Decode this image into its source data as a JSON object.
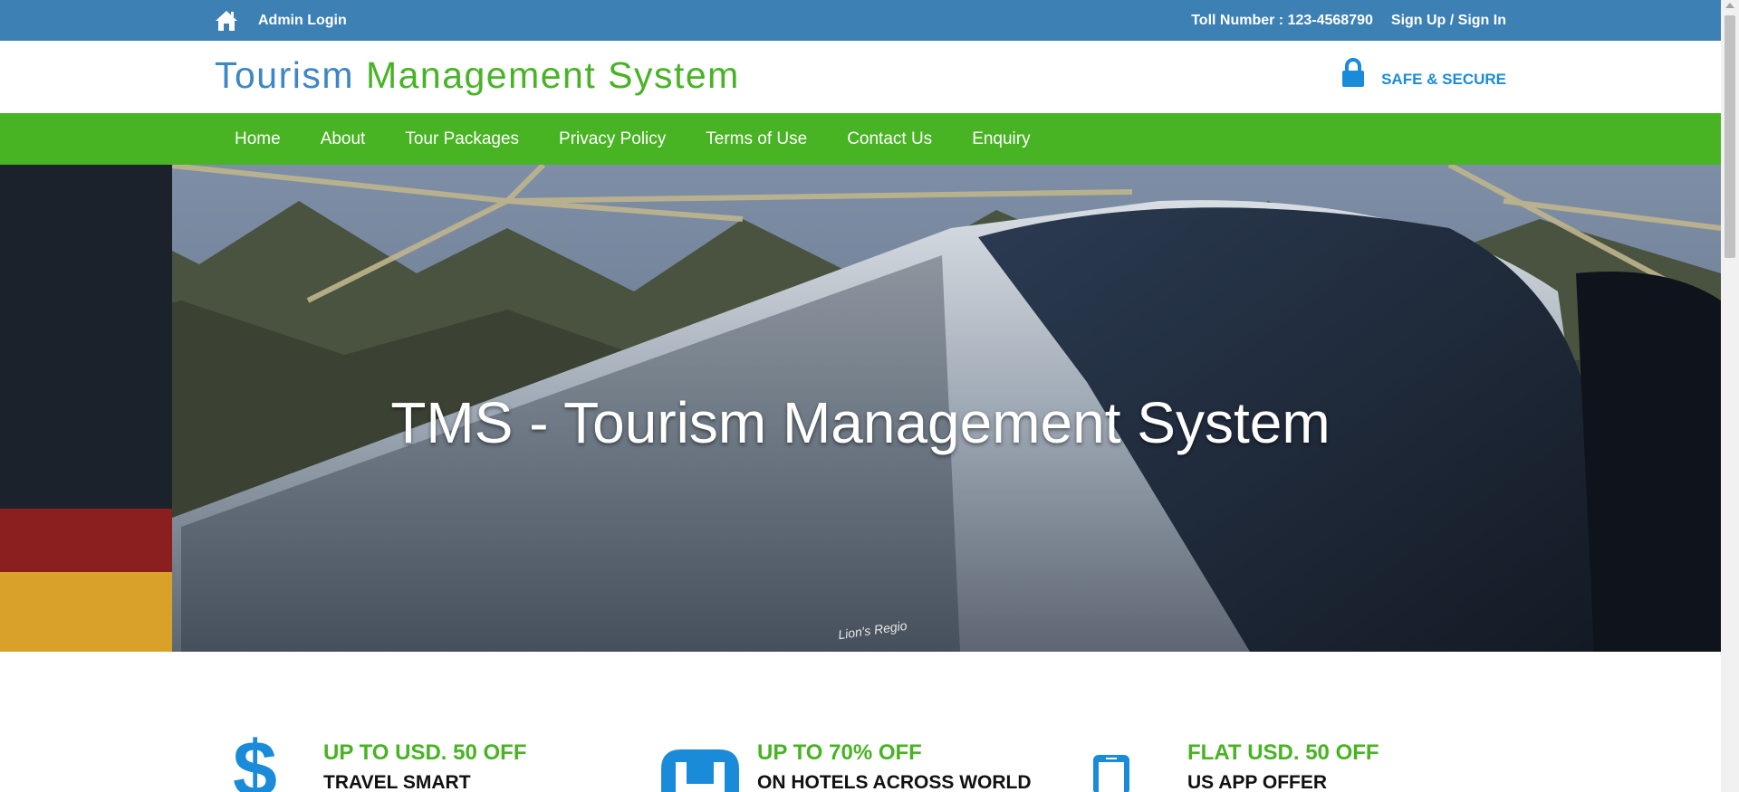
{
  "topbar": {
    "admin_login": "Admin Login",
    "toll_number": "Toll Number : 123-4568790",
    "sign_up_sign_in": "Sign Up / Sign In"
  },
  "header": {
    "logo_part1": "Tourism",
    "logo_part2": "Management System",
    "secure_text": "SAFE & SECURE"
  },
  "nav": {
    "items": [
      {
        "label": "Home"
      },
      {
        "label": "About"
      },
      {
        "label": "Tour Packages"
      },
      {
        "label": "Privacy Policy"
      },
      {
        "label": "Terms of Use"
      },
      {
        "label": "Contact Us"
      },
      {
        "label": "Enquiry"
      }
    ]
  },
  "banner": {
    "title": "TMS - Tourism Management System",
    "bus_plate_text": "Lion's Regio"
  },
  "features": [
    {
      "title": "UP TO USD. 50 OFF",
      "subtitle": "TRAVEL SMART",
      "icon": "dollar-icon"
    },
    {
      "title": "UP TO 70% OFF",
      "subtitle": "ON HOTELS ACROSS WORLD",
      "icon": "hotel-icon"
    },
    {
      "title": "FLAT USD. 50 OFF",
      "subtitle": "US APP OFFER",
      "icon": "mobile-icon"
    }
  ],
  "colors": {
    "topbar": "#3c80b4",
    "nav": "#48b323",
    "logo_blue": "#3f86c6",
    "logo_green": "#48b326",
    "secure_blue": "#1a8bd9"
  }
}
